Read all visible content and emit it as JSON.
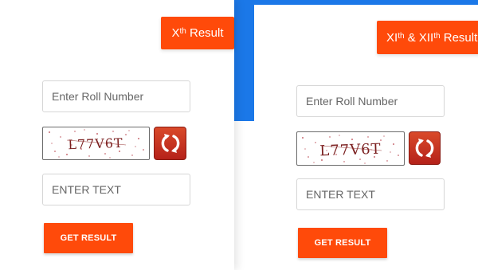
{
  "left_form": {
    "tab_base": "X",
    "tab_sup": "th",
    "tab_suffix": " Result",
    "roll_placeholder": "Enter Roll Number",
    "captcha_text": "L77V6T",
    "text_placeholder": "ENTER TEXT",
    "submit_label": "GET RESULT"
  },
  "right_form": {
    "tab_base1": "XI",
    "tab_sup1": "th",
    "tab_mid": " & XII",
    "tab_sup2": "th",
    "tab_suffix": " Result",
    "roll_placeholder": "Enter Roll Number",
    "captcha_text": "L77V6T",
    "text_placeholder": "ENTER TEXT",
    "submit_label": "GET RESULT"
  },
  "colors": {
    "accent": "#ff4a0a",
    "blue": "#1b78e8",
    "refresh": "#c0321c"
  },
  "icons": {
    "refresh": "refresh-icon"
  }
}
